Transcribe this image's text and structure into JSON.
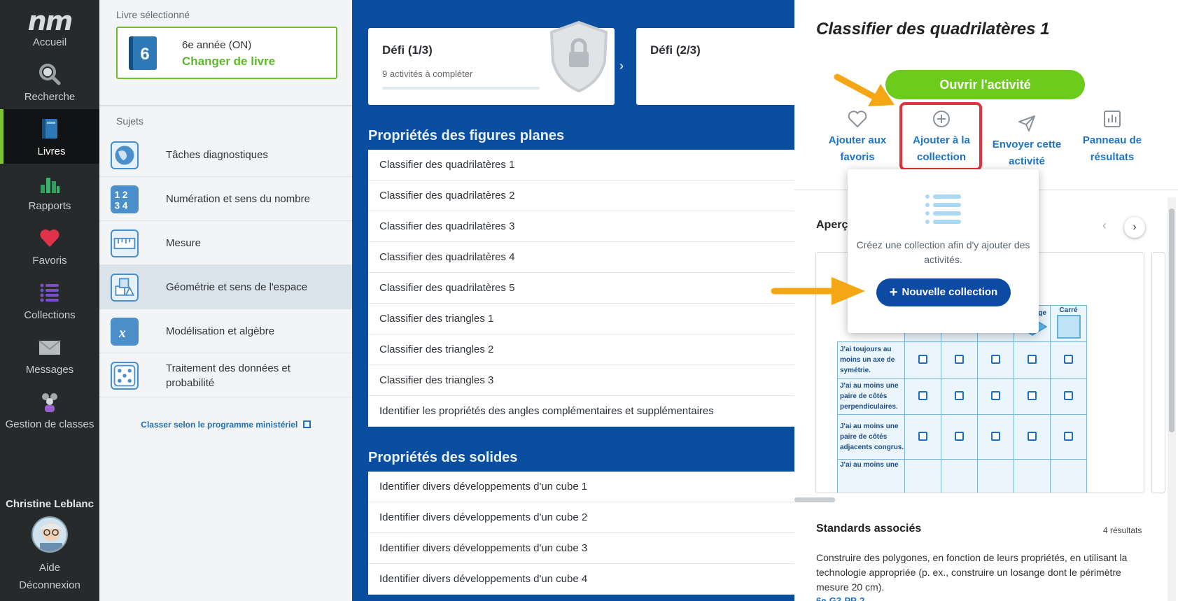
{
  "nav": {
    "logo": "nm",
    "items": [
      {
        "label": "Accueil",
        "icon": "home-icon"
      },
      {
        "label": "Recherche",
        "icon": "search-icon"
      },
      {
        "label": "Livres",
        "icon": "book-icon"
      },
      {
        "label": "Rapports",
        "icon": "bar-chart-icon"
      },
      {
        "label": "Favoris",
        "icon": "heart-icon"
      },
      {
        "label": "Collections",
        "icon": "list-icon"
      },
      {
        "label": "Messages",
        "icon": "envelope-icon"
      },
      {
        "label": "Gestion de classes",
        "icon": "class-group-icon"
      }
    ],
    "user_name": "Christine Leblanc",
    "help": "Aide",
    "logout": "Déconnexion"
  },
  "book_panel": {
    "selected_label": "Livre sélectionné",
    "book_number": "6",
    "book_grade": "6e année (ON)",
    "change_book": "Changer de livre",
    "subjects_label": "Sujets",
    "subjects": [
      {
        "label": "Tâches diagnostiques",
        "icon": "globe-icon"
      },
      {
        "label": "Numération et sens du nombre",
        "icon": "numbers-icon"
      },
      {
        "label": "Mesure",
        "icon": "ruler-icon"
      },
      {
        "label": "Géométrie et sens de l'espace",
        "icon": "cubes-icon"
      },
      {
        "label": "Modélisation et algèbre",
        "icon": "variable-x-icon"
      },
      {
        "label": "Traitement des données et probabilité",
        "icon": "dice-icon"
      }
    ],
    "program_link": "Classer selon le programme ministériel"
  },
  "main": {
    "defi1": {
      "title": "Défi (1/3)",
      "subtitle": "9 activités à compléter"
    },
    "defi2": {
      "title": "Défi (2/3)"
    },
    "section1": "Propriétés des figures planes",
    "section1_items": [
      "Classifier des quadrilatères 1",
      "Classifier des quadrilatères 2",
      "Classifier des quadrilatères 3",
      "Classifier des quadrilatères 4",
      "Classifier des quadrilatères 5",
      "Classifier des triangles 1",
      "Classifier des triangles 2",
      "Classifier des triangles 3",
      "Identifier les propriétés des angles complémentaires et supplémentaires"
    ],
    "section2": "Propriétés des solides",
    "section2_items": [
      "Identifier divers développements d'un cube 1",
      "Identifier divers développements d'un cube 2",
      "Identifier divers développements d'un cube 3",
      "Identifier divers développements d'un cube 4"
    ]
  },
  "right": {
    "title": "Classifier des quadrilatères 1",
    "open_button": "Ouvrir l'activité",
    "actions": {
      "fav": "Ajouter aux favoris",
      "collection": "Ajouter à la collection",
      "send": "Envoyer cette activité",
      "results": "Panneau de résultats"
    },
    "preview_label": "Aperçu",
    "preview_table": {
      "headers": [
        "Losange",
        "Carré"
      ],
      "rows": [
        "J'ai toujours au moins un axe de symétrie.",
        "J'ai au moins une paire de côtés perpendiculaires.",
        "J'ai au moins une paire de côtés adjacents congrus.",
        "J'ai au moins une"
      ]
    },
    "standards_title": "Standards associés",
    "standards_count": "4 résultats",
    "standards_text": "Construire des polygones, en fonction de leurs propriétés, en utilisant la technologie appropriée (p. ex., construire un losange dont le périmètre mesure 20 cm).",
    "standards_code": "6e-G3-PP-2"
  },
  "dropdown": {
    "text": "Créez une collection afin d'y ajouter des activités.",
    "new_button": "Nouvelle collection"
  },
  "colors": {
    "accent_green": "#6ccb1d",
    "brand_blue": "#0a4ea0",
    "highlight_red": "#e0343e",
    "arrow_orange": "#f5a614"
  }
}
